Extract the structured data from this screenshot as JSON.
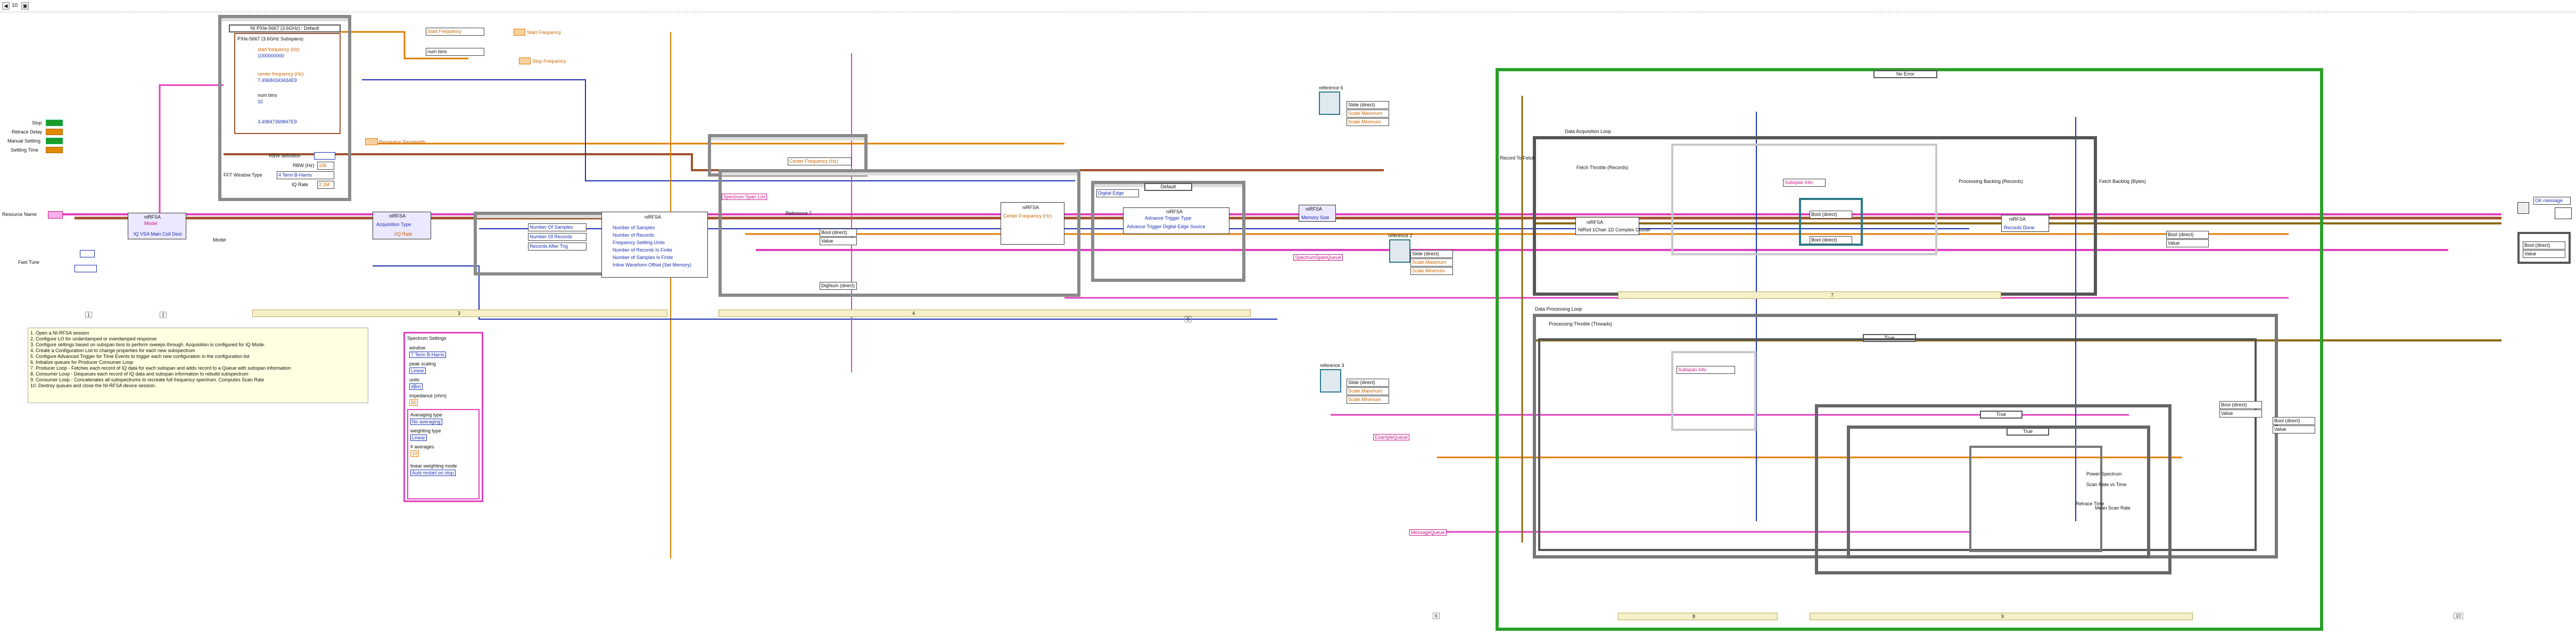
{
  "toolbar": {
    "zoom": "10"
  },
  "indicators": [
    {
      "label": "Stop",
      "value": "TF"
    },
    {
      "label": "Retrace Delay",
      "value": "DBL"
    },
    {
      "label": "Manual Settling",
      "value": "TF"
    },
    {
      "label": "Settling Time",
      "value": "TF"
    }
  ],
  "inputs": {
    "resource_name": "Resource Name",
    "fast_tune": "Fast Tune",
    "rbw_definition": "RBW definition",
    "rbw_hz": "RBW (Hz)",
    "rbw_hz_value": "10k",
    "fft_window_type": "FFT Window Type",
    "fft_window_value": "4 Term B-Harris",
    "iq_rate": "IQ Rate",
    "iq_rate_value": "2.1M",
    "resolution_bandwidth": "Resolution Bandwidth",
    "start_frequency": "Start Frequency",
    "stop_frequency": "Stop Frequency"
  },
  "property_node": {
    "title": "NI PXIe-5667 (3.6GHz) : Default",
    "sub": "PXIe-5667 (3.6GHz Subspans)",
    "rows": [
      "start frequency (Hz)",
      "1000000000",
      "center frequency (Hz)",
      "7.49684343434E9",
      "num bins",
      "32",
      "3.49847369847E9"
    ]
  },
  "vis": {
    "open": "niRFSA",
    "open_sub": "Model",
    "iq_vsa": "IQ VSA Main Coll Dest",
    "model_label": "Model",
    "acquisition": "Acquisition Type",
    "acq_value": "I/Q Rate",
    "configure": "niRFSA",
    "samples": [
      "Number Of Samples",
      "Number Of Records",
      "Records After Trig",
      "Number of Samples",
      "Number of Records",
      "Frequency Settling Units",
      "Number of Records Is Finite",
      "Number of Samples Is Finite",
      "Inline Waveform Offset (Set Memory)"
    ],
    "reference_start": "Spectrum Span List",
    "ref7": "Reference 7",
    "center_frequency_hz": "Center Frequency (Hz)",
    "bool_direct": "Bool (direct)",
    "dig_num": "DigNum (direct)",
    "value": "Value",
    "trigger_digital_edge": "Digital Edge",
    "trigger_default": "Default",
    "advance_trigger": "Advance Trigger Type",
    "advance_trigger_sub": "Advance Trigger Digital Edge Source",
    "memory_size": "Memory Size",
    "spectrum_span_queue": "SpectrumSpanQueue",
    "reference6": "reference 6",
    "reference2": "reference 2",
    "reference3": "reference 3",
    "slide_direct": "Slide (direct)",
    "scale_maximum": "Scale.Maximum",
    "scale_minimum": "Scale.Minimum",
    "queue1": "Queue1",
    "sub_queue1": "ExampleQueue",
    "message_queue": "MessageQueue"
  },
  "loops": {
    "no_error": "No Error",
    "daq_loop": "Data Acquisition Loop",
    "record_to_fetch": "Record To Fetch",
    "fetch_throttle": "Fetch Throttle (Records)",
    "fetch_cluster": "NiRsd 1Chan 1D Complex Cluster",
    "subspan_info": "Subspan Info",
    "fetch_backlog": "Fetch Backlog (Bytes)",
    "processing_backlog": "Processing Backlog (Records)",
    "records_done": "Records Done",
    "data_processing": "Data Processing Loop",
    "processing_throttle": "Processing Throttle (Threads)",
    "true_label": "True",
    "power_spectrum": "Power Spectrum",
    "scan_rate_vs_time": "Scan Rate vs Time",
    "retrace_time": "Retrace Time",
    "mean_scan_rate": "Mean Scan Rate",
    "gt_false": "True"
  },
  "spectrum_settings": {
    "title": "Spectrum Settings",
    "rows": [
      "window",
      "7 Term B-Harris",
      "peak scaling",
      "Linear",
      "units",
      "dBm",
      "impedance (ohm)",
      "50",
      "Averaging type",
      "No averaging",
      "weighting type",
      "Linear",
      "# averages",
      "10",
      "linear weighting mode",
      "Auto restart on stop"
    ]
  },
  "right": {
    "ok_message": "OK message",
    "error_out": "error out",
    "stop": "stop"
  },
  "notes": [
    "1. Open a NI-RFSA session",
    "2. Configure LO for underdamped or overdamped response",
    "3. Configure settings based on subspan bins to perform sweeps through. Acquisition is configured for IQ Mode.",
    "4. Create a Configuration List to change properties for each new subspectrum",
    "5. Configure Advanced Trigger for Time Events to trigger each new configuration in the configuration list",
    "6. Initialize queues for Producer Consumer Loop",
    "7. Producer Loop - Fetches each record of IQ data for each subspan and adds record to a Queue with subspan information",
    "8. Consumer Loop - Dequeues each record of IQ data and subspan information to rebuild subspectrum",
    "9. Consumer Loop - Concatenates all subspectrums to recreate full frequency spectrum. Computes Scan Rate",
    "10. Destroy queues and close the NI-RFSA device session."
  ],
  "frame_numbers": [
    "1",
    "2",
    "3",
    "4",
    "5",
    "6",
    "7",
    "8",
    "9",
    "10"
  ],
  "colors": {
    "orange_wire": "#e07b00",
    "blue_wire": "#1a2fb0",
    "pink_wire": "#e040c0",
    "brown_wire": "#a0522d",
    "green_frame": "#2aa02a",
    "dark_frame": "#555555"
  }
}
